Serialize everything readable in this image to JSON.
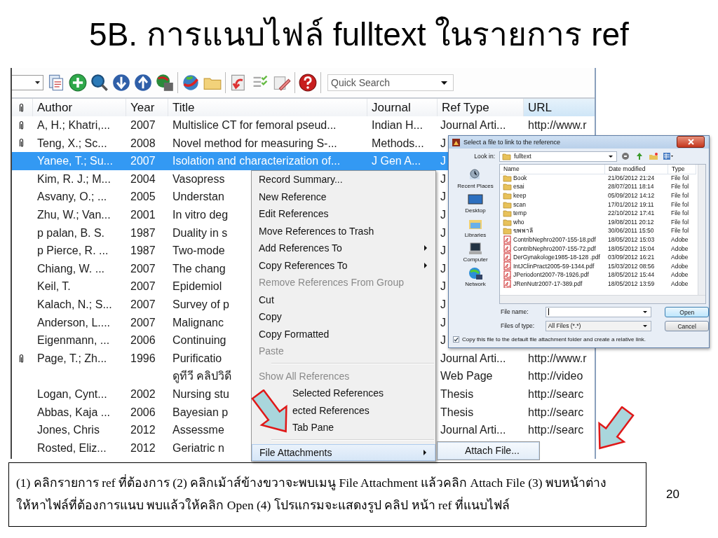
{
  "slide": {
    "title": "5B. การแนบไฟล์ fulltext ในรายการ ref",
    "caption": "(1) คลิกรายการ ref ที่ต้องการ  (2) คลิกเม้าส์ข้างขวาจะพบเมนู File Attachment  แล้วคลิก  Attach File   (3) พบหน้าต่าง ให้หาไฟล์ที่ต้องการแนบ พบแล้วให้คลิก Open (4) โปรแกรมจะแสดงรูป คลิป หน้า ref ที่แนบไฟล์",
    "page_number": "20"
  },
  "toolbar": {
    "search": {
      "placeholder": "Quick Search"
    }
  },
  "table": {
    "columns": [
      {
        "label": "Author",
        "sorted": false
      },
      {
        "label": "Year",
        "sorted": false
      },
      {
        "label": "Title",
        "sorted": false
      },
      {
        "label": "Journal",
        "sorted": false
      },
      {
        "label": "Ref Type",
        "sorted": false
      },
      {
        "label": "URL",
        "sorted": true
      }
    ],
    "rows": [
      {
        "attachment": true,
        "selected": false,
        "cells": [
          "A, H.; Khatri,...",
          "2007",
          "Multislice CT for femoral pseud...",
          "Indian H...",
          "Journal Arti...",
          "http://www.r"
        ]
      },
      {
        "attachment": true,
        "selected": false,
        "cells": [
          "Teng, X.; Sc...",
          "2008",
          "Novel method for measuring S-...",
          "Methods...",
          "J",
          null
        ]
      },
      {
        "attachment": false,
        "selected": true,
        "cells": [
          "Yanee, T.; Su...",
          "2007",
          "Isolation and characterization of...",
          "J Gen A...",
          "J",
          null
        ]
      },
      {
        "attachment": false,
        "selected": false,
        "cells": [
          "Kim, R. J.; M...",
          "2004",
          "Vasopress",
          null,
          "J",
          null
        ]
      },
      {
        "attachment": false,
        "selected": false,
        "cells": [
          "Asvany, O.; ...",
          "2005",
          "Understan",
          null,
          "J",
          null
        ]
      },
      {
        "attachment": false,
        "selected": false,
        "cells": [
          "Zhu, W.; Van...",
          "2001",
          "In vitro deg",
          null,
          "J",
          null
        ]
      },
      {
        "attachment": false,
        "selected": false,
        "cells": [
          "p palan, B. S.",
          "1987",
          "Duality in s",
          null,
          "J",
          null
        ]
      },
      {
        "attachment": false,
        "selected": false,
        "cells": [
          "p Pierce, R. ...",
          "1987",
          "Two-mode",
          null,
          "J",
          null
        ]
      },
      {
        "attachment": false,
        "selected": false,
        "cells": [
          "Chiang, W. ...",
          "2007",
          "The chang",
          null,
          "J",
          null
        ]
      },
      {
        "attachment": false,
        "selected": false,
        "cells": [
          "Keil, T.",
          "2007",
          "Epidemiol",
          null,
          "J",
          null
        ]
      },
      {
        "attachment": false,
        "selected": false,
        "cells": [
          "Kalach, N.; S...",
          "2007",
          "Survey of p",
          null,
          "J",
          null
        ]
      },
      {
        "attachment": false,
        "selected": false,
        "cells": [
          "Anderson, L....",
          "2007",
          "Malignanc",
          null,
          "J",
          null
        ]
      },
      {
        "attachment": false,
        "selected": false,
        "cells": [
          "Eigenmann, ...",
          "2006",
          "Continuing",
          null,
          "J",
          null
        ]
      },
      {
        "attachment": true,
        "selected": false,
        "cells": [
          "Page, T.; Zh...",
          "1996",
          "Purificatio",
          null,
          "Journal Arti...",
          "http://www.r"
        ]
      },
      {
        "attachment": false,
        "selected": false,
        "cells": [
          null,
          null,
          "ดูทีวี คลิปวิดี",
          null,
          "Web Page",
          "http://video"
        ]
      },
      {
        "attachment": false,
        "selected": false,
        "cells": [
          "Logan, Cynt...",
          "2002",
          "Nursing stu",
          null,
          "Thesis",
          "http://searc"
        ]
      },
      {
        "attachment": false,
        "selected": false,
        "cells": [
          "Abbas, Kaja ...",
          "2006",
          "Bayesian p",
          null,
          "Thesis",
          "http://searc"
        ]
      },
      {
        "attachment": false,
        "selected": false,
        "cells": [
          "Jones, Chris",
          "2012",
          "Assessme",
          null,
          "Journal Arti...",
          "http://searc"
        ]
      },
      {
        "attachment": false,
        "selected": false,
        "cells": [
          "Rosted, Eliz...",
          "2012",
          "Geriatric n",
          null,
          null,
          null
        ]
      }
    ]
  },
  "context_menu": {
    "groups": [
      {
        "items": [
          {
            "label": "Record Summary...",
            "disabled": false,
            "submenu": false,
            "selected": false,
            "covered": false
          },
          {
            "label": "New Reference",
            "disabled": false,
            "submenu": false,
            "selected": false,
            "covered": false
          },
          {
            "label": "Edit References",
            "disabled": false,
            "submenu": false,
            "selected": false,
            "covered": false
          },
          {
            "label": "Move References to Trash",
            "disabled": false,
            "submenu": false,
            "selected": false,
            "covered": false
          },
          {
            "label": "Add References To",
            "disabled": false,
            "submenu": true,
            "selected": false,
            "covered": false
          },
          {
            "label": "Copy References To",
            "disabled": false,
            "submenu": true,
            "selected": false,
            "covered": false
          },
          {
            "label": "Remove References From Group",
            "disabled": true,
            "submenu": false,
            "selected": false,
            "covered": false
          },
          {
            "label": "Cut",
            "disabled": false,
            "submenu": false,
            "selected": false,
            "covered": false
          },
          {
            "label": "Copy",
            "disabled": false,
            "submenu": false,
            "selected": false,
            "covered": false
          },
          {
            "label": "Copy Formatted",
            "disabled": false,
            "submenu": false,
            "selected": false,
            "covered": false
          },
          {
            "label": "Paste",
            "disabled": true,
            "submenu": false,
            "selected": false,
            "covered": false
          }
        ]
      },
      {
        "items": [
          {
            "label": "Show All References",
            "disabled": true,
            "submenu": false,
            "selected": false,
            "covered": false
          },
          {
            "label": "Selected References",
            "disabled": false,
            "submenu": false,
            "selected": false,
            "covered": true
          },
          {
            "label": "ected References",
            "disabled": false,
            "submenu": false,
            "selected": false,
            "covered": true
          },
          {
            "label": "Tab Pane",
            "disabled": false,
            "submenu": false,
            "selected": false,
            "covered": true
          }
        ]
      },
      {
        "items": [
          {
            "label": "File Attachments",
            "disabled": false,
            "submenu": true,
            "selected": true,
            "covered": false
          }
        ]
      }
    ]
  },
  "submenu": {
    "items": [
      {
        "label": "Attach File...",
        "selected": true
      }
    ]
  },
  "dialog": {
    "title": "Select a file to link to the reference",
    "look_in_label": "Look in:",
    "look_in": "fulltext",
    "places": [
      "Recent Places",
      "Desktop",
      "Libraries",
      "Computer",
      "Network"
    ],
    "columns": [
      "Name",
      "Date modified",
      "Type"
    ],
    "files": [
      {
        "kind": "folder",
        "name": "Book",
        "date": "21/06/2012 21:24",
        "type": "File fol"
      },
      {
        "kind": "folder",
        "name": "esai",
        "date": "28/07/2011 18:14",
        "type": "File fol"
      },
      {
        "kind": "folder",
        "name": "keep",
        "date": "05/09/2012 14:12",
        "type": "File fol"
      },
      {
        "kind": "folder",
        "name": "scan",
        "date": "17/01/2012 19:11",
        "type": "File fol"
      },
      {
        "kind": "folder",
        "name": "temp",
        "date": "22/10/2012 17:41",
        "type": "File fol"
      },
      {
        "kind": "folder",
        "name": "who",
        "date": "19/08/2011 20:12",
        "type": "File fol"
      },
      {
        "kind": "folder",
        "name": "ฆพพาลี",
        "date": "30/06/2011 15:50",
        "type": "File fol"
      },
      {
        "kind": "pdf",
        "name": "ContribNephro2007-155-18.pdf",
        "date": "18/05/2012 15:03",
        "type": "Adobe"
      },
      {
        "kind": "pdf",
        "name": "ContribNephro2007-155-72.pdf",
        "date": "18/05/2012 15:04",
        "type": "Adobe"
      },
      {
        "kind": "pdf",
        "name": "DerGynakologe1985-18-128 .pdf",
        "date": "03/09/2012 16:21",
        "type": "Adobe"
      },
      {
        "kind": "pdf",
        "name": "IntJClinPract2005-59-1344.pdf",
        "date": "15/03/2012 08:56",
        "type": "Adobe"
      },
      {
        "kind": "pdf",
        "name": "JPeriodont2007-78-1926.pdf",
        "date": "18/05/2012 15:44",
        "type": "Adobe"
      },
      {
        "kind": "pdf",
        "name": "JRenNutr2007-17-389.pdf",
        "date": "18/05/2012 13:59",
        "type": "Adobe"
      }
    ],
    "file_name_label": "File name:",
    "files_of_type_label": "Files of type:",
    "files_of_type": "All Files (*.*)",
    "buttons": [
      "Open",
      "Cancel"
    ],
    "copy_option": {
      "label": "Copy this file to the default file attachment folder and create a relative link.",
      "checked": true
    }
  }
}
